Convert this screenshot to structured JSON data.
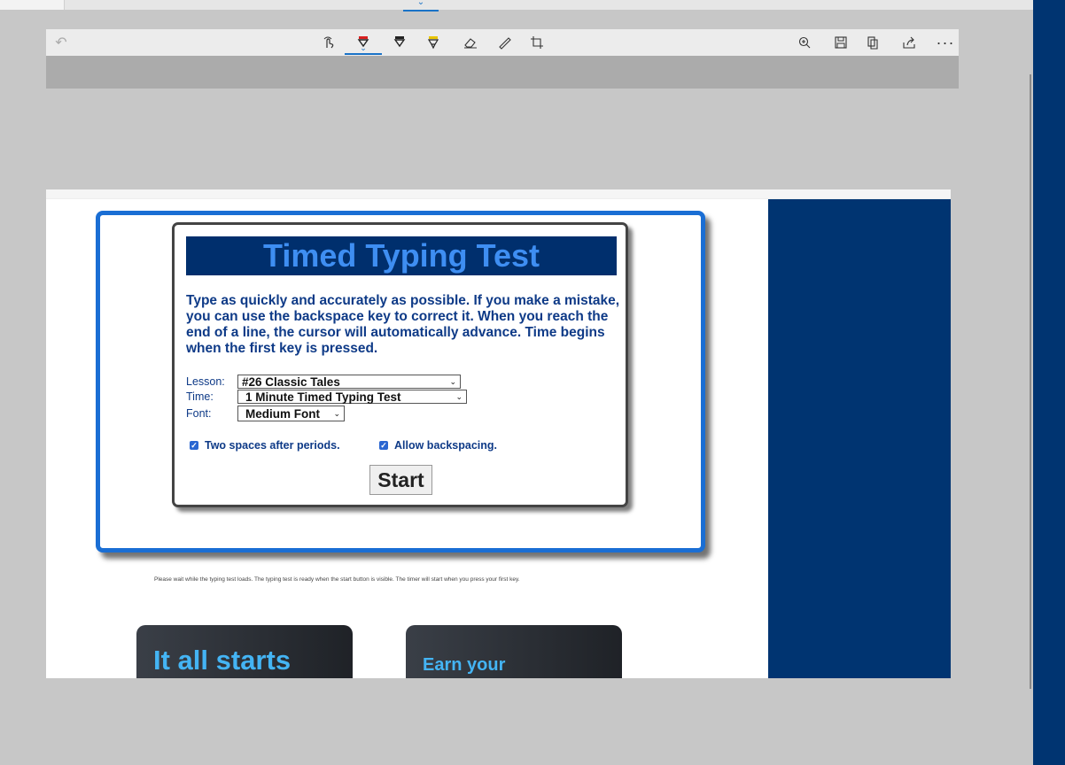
{
  "browser": {
    "collapse_glyph": "⌄"
  },
  "toolbar": {
    "icons": [
      "undo-icon",
      "touch-draw-icon",
      "red-pen-icon",
      "black-pen-icon",
      "highlighter-icon",
      "eraser-icon",
      "ruler-icon",
      "crop-icon",
      "zoom-in-icon",
      "save-icon",
      "copy-icon",
      "share-icon",
      "more-icon"
    ],
    "more_glyph": "···",
    "pen_color_red": "#d92020",
    "highlighter_color": "#e8c400",
    "accent": "#1a73c7"
  },
  "test": {
    "title": "Timed Typing Test",
    "description": "Type as quickly and accurately as possible. If you make a mistake, you can use the backspace key to correct it. When you reach the end of a line, the cursor will automatically advance. Time begins when the first key is pressed.",
    "lesson_label": "Lesson:",
    "lesson_value": "#26 Classic Tales",
    "time_label": "Time:",
    "time_value": "1 Minute Timed Typing Test",
    "font_label": "Font:",
    "font_value": "Medium Font",
    "option_two_spaces": "Two spaces after periods.",
    "option_backspacing": "Allow backspacing.",
    "start_label": "Start",
    "wait_note": "Please wait while the typing test loads. The typing test is ready when the start button is visible. The timer will start when you press your first key."
  },
  "promos": [
    {
      "text": "It all starts"
    },
    {
      "text": "Earn your"
    }
  ],
  "colors": {
    "frame_blue": "#1a6ed4",
    "title_bg": "#002f6d",
    "title_text": "#3e8ef2",
    "navy_panel": "#003471"
  }
}
